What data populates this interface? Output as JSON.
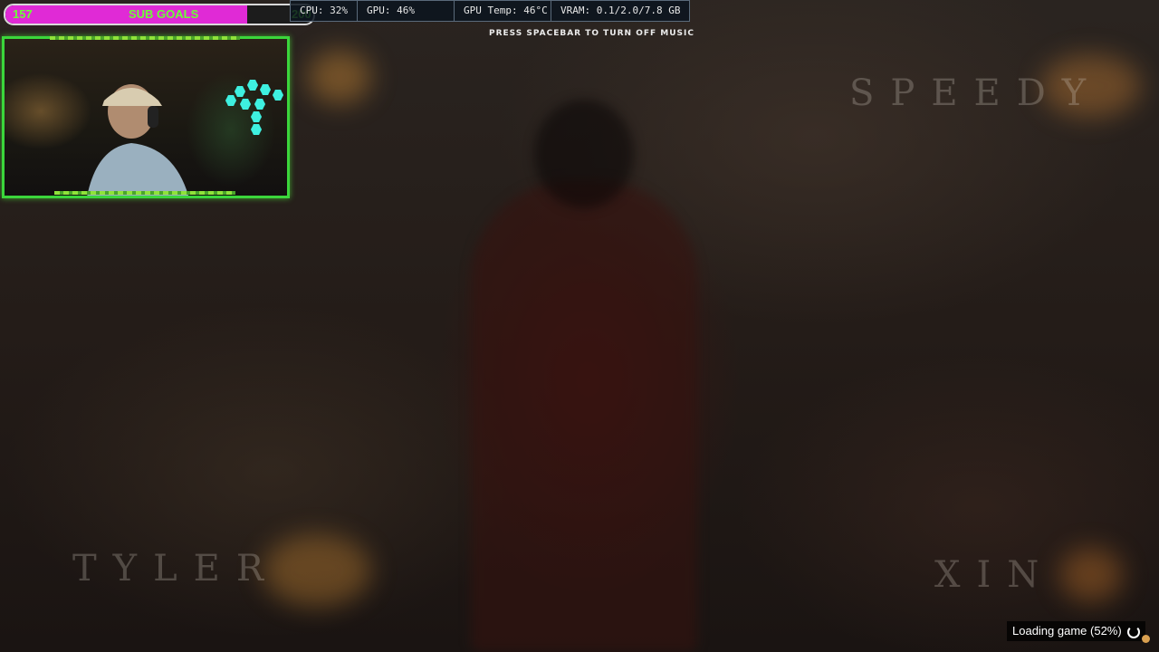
{
  "overlay": {
    "sub_goals": {
      "current": "157",
      "label": "SUB GOALS",
      "target": "200",
      "progress_fraction": 0.785,
      "fill_color": "#e02ad6",
      "text_color": "#6bff35"
    },
    "stats": [
      {
        "label": "CPU: 32%"
      },
      {
        "label": "GPU: 46%"
      },
      {
        "label": "GPU Temp: 46°C"
      },
      {
        "label": "VRAM: 0.1/2.0/7.8 GB"
      }
    ],
    "music_hint": "PRESS SPACEBAR TO TURN OFF MUSIC",
    "webcam": {
      "frame_color": "#3bd63b",
      "panel_color": "#3ef0e0"
    }
  },
  "game": {
    "credits": [
      "SPEEDY",
      "TYLER",
      "XIN"
    ],
    "loading_text": "Loading game (52%)",
    "loading_spinner": "spinner-icon"
  }
}
